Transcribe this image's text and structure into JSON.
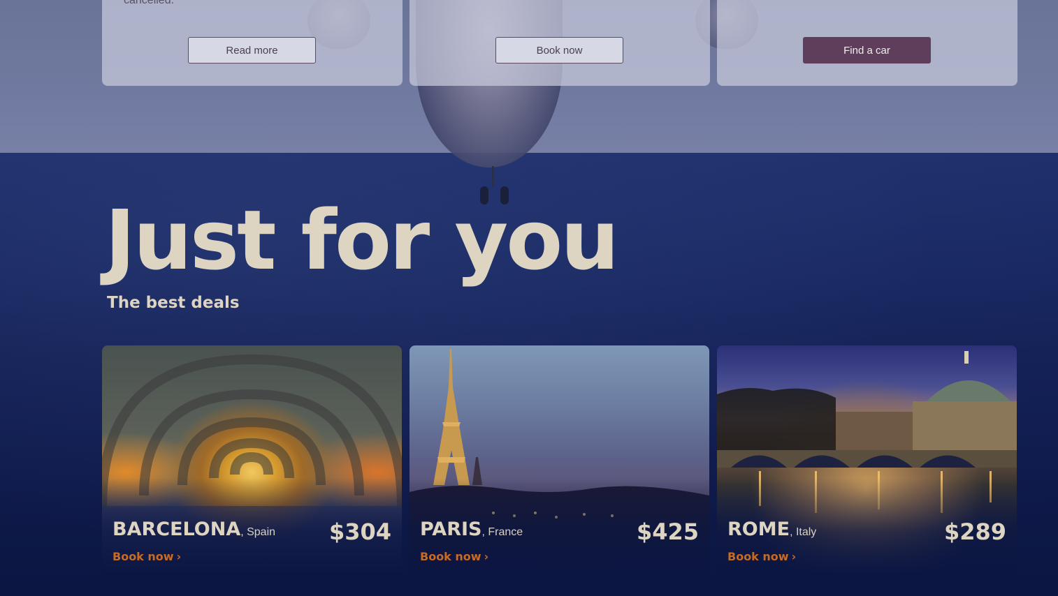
{
  "top_section": {
    "cut_text": "cancelled.",
    "cards": [
      {
        "button_label": "Read more"
      },
      {
        "button_label": "Book now"
      },
      {
        "button_label": "Find a car"
      }
    ]
  },
  "hero": {
    "headline": "Just for you",
    "subheadline": "The best deals"
  },
  "deals": [
    {
      "city": "BARCELONA",
      "country": ", Spain",
      "price": "$304",
      "cta": "Book now"
    },
    {
      "city": "PARIS",
      "country": ", France",
      "price": "$425",
      "cta": "Book now"
    },
    {
      "city": "ROME",
      "country": ", Italy",
      "price": "$289",
      "cta": "Book now"
    }
  ],
  "colors": {
    "background": "#0e1a45",
    "headline": "#ddd4c2",
    "cta": "#c86a24",
    "filled_button": "#5e3e5a"
  }
}
